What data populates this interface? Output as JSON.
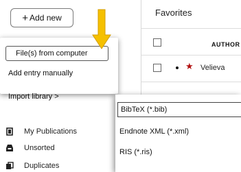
{
  "sidebar": {
    "add_new_plus": "+",
    "add_new_label": "Add new",
    "items": [
      {
        "label": "My Publications",
        "icon": "document-icon"
      },
      {
        "label": "Unsorted",
        "icon": "inbox-icon"
      },
      {
        "label": "Duplicates",
        "icon": "copy-icon"
      }
    ]
  },
  "main": {
    "title": "Favorites",
    "column_author": "AUTHOR",
    "row_author": "Velieva",
    "star_color": "#b21010"
  },
  "menu": {
    "items": [
      {
        "label": "File(s) from computer"
      },
      {
        "label": "Add entry manually"
      },
      {
        "label": "Import library >"
      }
    ]
  },
  "submenu": {
    "items": [
      {
        "label": "BibTeX (*.bib)"
      },
      {
        "label": "Endnote XML (*.xml)"
      },
      {
        "label": "RIS (*.ris)"
      }
    ]
  },
  "colors": {
    "pointer": "#f5c000",
    "pointer_outline": "#d39c00"
  }
}
